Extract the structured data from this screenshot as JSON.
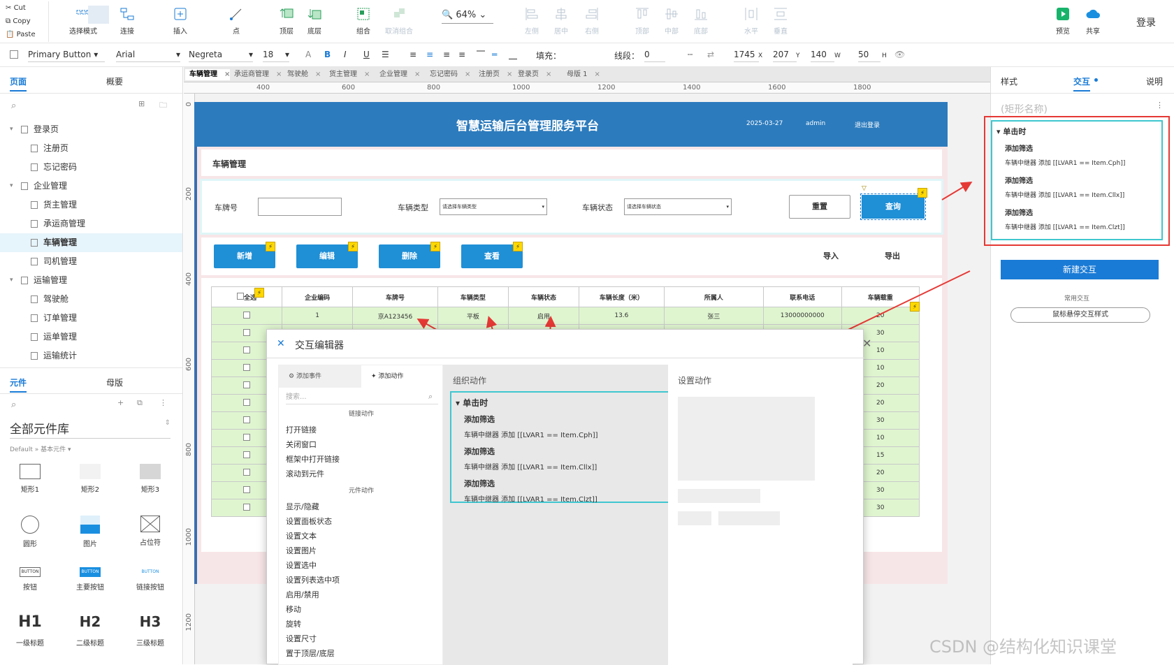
{
  "toolbar": {
    "clipboard": [
      "Cut",
      "Copy",
      "Paste"
    ],
    "buttons": [
      "选择模式",
      "连接",
      "插入",
      "点",
      "顶层",
      "底层",
      "组合",
      "取消组合",
      "左侧",
      "居中",
      "右侧",
      "顶部",
      "中部",
      "底部",
      "水平",
      "垂直"
    ],
    "zoom": "64%",
    "preview": "预览",
    "share": "共享",
    "login": "登录"
  },
  "format": {
    "style": "Primary Button",
    "font": "Arial",
    "weight": "Negreta",
    "size": "18",
    "fill_label": "填充：",
    "line_label": "线段：",
    "line_value": "0",
    "x": "1745",
    "y": "207",
    "w": "140",
    "h": "50",
    "x_label": "X",
    "y_label": "Y",
    "w_label": "W",
    "h_label": "H"
  },
  "left": {
    "tabs": [
      "页面",
      "概要"
    ],
    "pages": [
      {
        "label": "登录页",
        "level": 0,
        "folder": true
      },
      {
        "label": "注册页",
        "level": 1
      },
      {
        "label": "忘记密码",
        "level": 1
      },
      {
        "label": "企业管理",
        "level": 0,
        "folder": true
      },
      {
        "label": "货主管理",
        "level": 1
      },
      {
        "label": "承运商管理",
        "level": 1
      },
      {
        "label": "车辆管理",
        "level": 1,
        "selected": true
      },
      {
        "label": "司机管理",
        "level": 1
      },
      {
        "label": "运输管理",
        "level": 0,
        "folder": true
      },
      {
        "label": "驾驶舱",
        "level": 1
      },
      {
        "label": "订单管理",
        "level": 1
      },
      {
        "label": "运单管理",
        "level": 1
      },
      {
        "label": "运输统计",
        "level": 1
      }
    ],
    "lib_tabs": [
      "元件",
      "母版"
    ],
    "lib_title": "全部元件库",
    "lib_sub": "Default » 基本元件",
    "widgets": [
      "矩形1",
      "矩形2",
      "矩形3",
      "圆形",
      "图片",
      "占位符",
      "按钮",
      "主要按钮",
      "链接按钮",
      "一级标题",
      "二级标题",
      "三级标题"
    ],
    "widget_text": {
      "btn": "BUTTON",
      "h1": "H1",
      "h2": "H2",
      "h3": "H3"
    }
  },
  "doc_tabs": [
    "车辆管理",
    "承运商管理",
    "驾驶舱",
    "货主管理",
    "企业管理",
    "忘记密码",
    "注册页",
    "登录页",
    "母版 1"
  ],
  "ruler_h": [
    "400",
    "600",
    "800",
    "1000",
    "1200",
    "1400",
    "1600",
    "1800"
  ],
  "ruler_v": [
    "0",
    "200",
    "400",
    "600",
    "800",
    "1000",
    "1200"
  ],
  "page": {
    "title": "智慧运输后台管理服务平台",
    "date": "2025-03-27",
    "user": "admin",
    "logout": "退出登录",
    "section": "车辆管理",
    "filter": {
      "plate_label": "车牌号",
      "type_label": "车辆类型",
      "type_ph": "请选择车辆类型",
      "status_label": "车辆状态",
      "status_ph": "请选择车辆状态",
      "reset": "重置",
      "query": "查询"
    },
    "actions": [
      "新增",
      "编辑",
      "删除",
      "查看"
    ],
    "import": "导入",
    "export": "导出",
    "table_headers": [
      "全选",
      "企业编码",
      "车牌号",
      "车辆类型",
      "车辆状态",
      "车辆长度（米）",
      "所属人",
      "联系电话",
      "车辆载重"
    ],
    "row1": [
      "1",
      "京A123456",
      "平板",
      "启用",
      "13.6",
      "张三",
      "13000000000",
      "20"
    ],
    "weights": [
      "30",
      "10",
      "10",
      "20",
      "20",
      "30",
      "10",
      "15",
      "20",
      "30",
      "30"
    ]
  },
  "dialog": {
    "title": "交互编辑器",
    "tabs": [
      "添加事件",
      "添加动作"
    ],
    "search_ph": "搜索...",
    "groups": [
      "链接动作",
      "元件动作"
    ],
    "link_actions": [
      "打开链接",
      "关闭窗口",
      "框架中打开链接",
      "滚动到元件"
    ],
    "widget_actions": [
      "显示/隐藏",
      "设置面板状态",
      "设置文本",
      "设置图片",
      "设置选中",
      "设置列表选中项",
      "启用/禁用",
      "移动",
      "旋转",
      "设置尺寸",
      "置于顶层/底层"
    ],
    "organize": "组织动作",
    "set_action": "设置动作",
    "event": "单击时",
    "items": [
      {
        "title": "添加筛选",
        "desc": "车辆中继器 添加 [[LVAR1 == Item.Cph]]"
      },
      {
        "title": "添加筛选",
        "desc": "车辆中继器 添加 [[LVAR1 == Item.Cllx]]"
      },
      {
        "title": "添加筛选",
        "desc": "车辆中继器 添加 [[LVAR1 == Item.Clzt]]"
      }
    ]
  },
  "right": {
    "tabs": [
      "样式",
      "交互",
      "说明"
    ],
    "name_ph": "(矩形名称)",
    "new_btn": "新建交互",
    "common": "常用交互",
    "hover": "鼠标悬停交互样式"
  },
  "watermark": "CSDN @结构化知识课堂",
  "colors": {
    "accent": "#1a7bd6",
    "header": "#2c7bbd",
    "button": "#1f8fd6",
    "highlight": "#e53935",
    "teal": "#3fc6cf"
  }
}
